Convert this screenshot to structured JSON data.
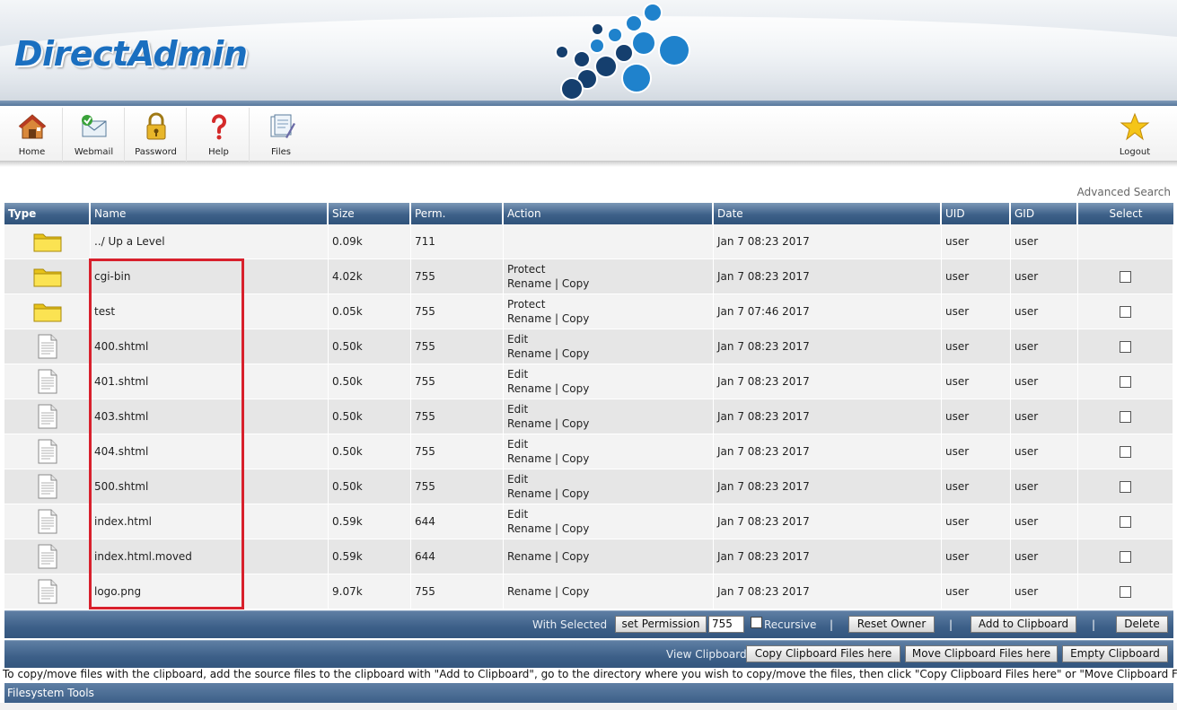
{
  "brand": {
    "name": "DirectAdmin"
  },
  "toolbar": {
    "items": [
      {
        "label": "Home",
        "icon": "home-icon"
      },
      {
        "label": "Webmail",
        "icon": "webmail-icon"
      },
      {
        "label": "Password",
        "icon": "lock-icon"
      },
      {
        "label": "Help",
        "icon": "help-icon"
      },
      {
        "label": "Files",
        "icon": "files-icon"
      }
    ],
    "logout": {
      "label": "Logout",
      "icon": "star-icon"
    }
  },
  "advanced_search": "Advanced Search",
  "table": {
    "columns": [
      "Type",
      "Name",
      "Size",
      "Perm.",
      "Action",
      "Date",
      "UID",
      "GID",
      "Select"
    ],
    "action_labels": {
      "protect": "Protect",
      "edit": "Edit",
      "rename": "Rename",
      "separator": "|",
      "copy": "Copy"
    },
    "rows": [
      {
        "type": "folder",
        "name": "../ Up a Level",
        "size": "0.09k",
        "perm": "711",
        "primary_action": "",
        "has_rename": false,
        "date": "Jan 7 08:23 2017",
        "uid": "user",
        "gid": "user",
        "selectable": false
      },
      {
        "type": "folder",
        "name": "cgi-bin",
        "size": "4.02k",
        "perm": "755",
        "primary_action": "Protect",
        "has_rename": true,
        "date": "Jan 7 08:23 2017",
        "uid": "user",
        "gid": "user",
        "selectable": true
      },
      {
        "type": "folder",
        "name": "test",
        "size": "0.05k",
        "perm": "755",
        "primary_action": "Protect",
        "has_rename": true,
        "date": "Jan 7 07:46 2017",
        "uid": "user",
        "gid": "user",
        "selectable": true
      },
      {
        "type": "file",
        "name": "400.shtml",
        "size": "0.50k",
        "perm": "755",
        "primary_action": "Edit",
        "has_rename": true,
        "date": "Jan 7 08:23 2017",
        "uid": "user",
        "gid": "user",
        "selectable": true
      },
      {
        "type": "file",
        "name": "401.shtml",
        "size": "0.50k",
        "perm": "755",
        "primary_action": "Edit",
        "has_rename": true,
        "date": "Jan 7 08:23 2017",
        "uid": "user",
        "gid": "user",
        "selectable": true
      },
      {
        "type": "file",
        "name": "403.shtml",
        "size": "0.50k",
        "perm": "755",
        "primary_action": "Edit",
        "has_rename": true,
        "date": "Jan 7 08:23 2017",
        "uid": "user",
        "gid": "user",
        "selectable": true
      },
      {
        "type": "file",
        "name": "404.shtml",
        "size": "0.50k",
        "perm": "755",
        "primary_action": "Edit",
        "has_rename": true,
        "date": "Jan 7 08:23 2017",
        "uid": "user",
        "gid": "user",
        "selectable": true
      },
      {
        "type": "file",
        "name": "500.shtml",
        "size": "0.50k",
        "perm": "755",
        "primary_action": "Edit",
        "has_rename": true,
        "date": "Jan 7 08:23 2017",
        "uid": "user",
        "gid": "user",
        "selectable": true
      },
      {
        "type": "file",
        "name": "index.html",
        "size": "0.59k",
        "perm": "644",
        "primary_action": "Edit",
        "has_rename": true,
        "date": "Jan 7 08:23 2017",
        "uid": "user",
        "gid": "user",
        "selectable": true
      },
      {
        "type": "file",
        "name": "index.html.moved",
        "size": "0.59k",
        "perm": "644",
        "primary_action": "",
        "has_rename": true,
        "date": "Jan 7 08:23 2017",
        "uid": "user",
        "gid": "user",
        "selectable": true
      },
      {
        "type": "file",
        "name": "logo.png",
        "size": "9.07k",
        "perm": "755",
        "primary_action": "",
        "has_rename": true,
        "date": "Jan 7 08:23 2017",
        "uid": "user",
        "gid": "user",
        "selectable": true
      }
    ]
  },
  "selected_bar": {
    "label": "With Selected",
    "set_permission": "set Permission",
    "permission_value": "755",
    "recursive": "Recursive",
    "separator": "|",
    "reset_owner": "Reset Owner",
    "add_to_clipboard": "Add to Clipboard",
    "delete": "Delete"
  },
  "clipboard_bar": {
    "label": "View Clipboard",
    "copy_here": "Copy Clipboard Files here",
    "move_here": "Move Clipboard Files here",
    "empty": "Empty Clipboard"
  },
  "clipboard_note": "To copy/move files with the clipboard, add the source files to the clipboard with \"Add to Clipboard\", go to the directory where you wish to copy/move the files, then click \"Copy Clipboard Files here\" or \"Move Clipboard Files here\"",
  "filesystem_tools": "Filesystem Tools",
  "colors": {
    "header_blue": "#3e6189",
    "brand_blue": "#1a6fc0",
    "highlight_red": "#d8202c",
    "row_light": "#f3f3f3",
    "row_dark": "#e6e6e6"
  }
}
